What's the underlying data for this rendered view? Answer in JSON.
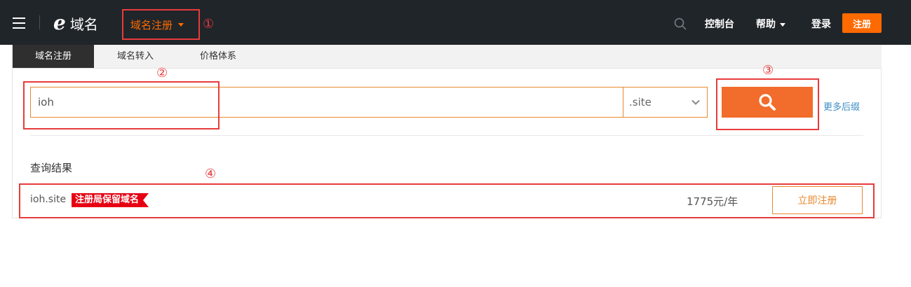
{
  "header": {
    "logo_letter": "e",
    "logo_text": "域名",
    "nav_domain_label": "域名注册",
    "links": {
      "console": "控制台",
      "help": "帮助",
      "login": "登录",
      "register": "注册"
    },
    "icons": [
      "menu-icon",
      "search-icon",
      "caret-down-icon"
    ],
    "colors": {
      "background": "#20252a",
      "accent": "#ff6a00"
    }
  },
  "tabs": [
    {
      "label": "域名注册",
      "active": true
    },
    {
      "label": "域名转入",
      "active": false
    },
    {
      "label": "价格体系",
      "active": false
    }
  ],
  "search": {
    "query": "ioh",
    "suffix": ".site",
    "more_suffix_label": "更多后缀",
    "button_color": "#f26c2b"
  },
  "results": {
    "title": "查询结果",
    "items": [
      {
        "domain": "ioh.site",
        "tag": "注册局保留域名",
        "price": "1775元/年",
        "action": "立即注册"
      }
    ]
  },
  "annotations": [
    "①",
    "②",
    "③",
    "④"
  ]
}
